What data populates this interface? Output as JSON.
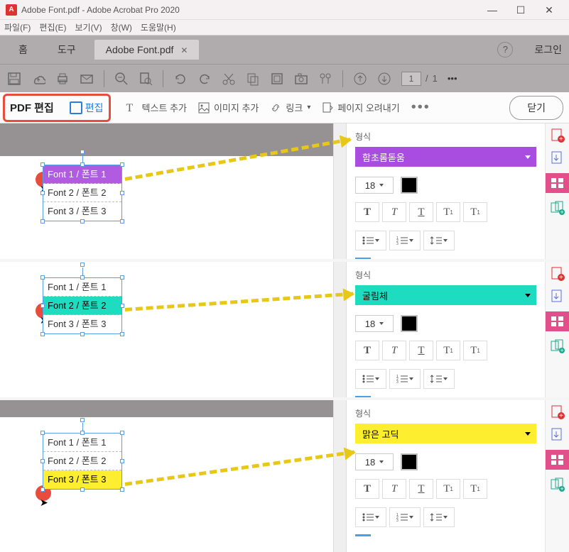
{
  "titlebar": {
    "title": "Adobe Font.pdf - Adobe Acrobat Pro 2020"
  },
  "menubar": {
    "file": "파일(F)",
    "edit": "편집(E)",
    "view": "보기(V)",
    "window": "창(W)",
    "help": "도움말(H)"
  },
  "tabs": {
    "home": "홈",
    "tools": "도구",
    "doc": "Adobe Font.pdf",
    "login": "로그인"
  },
  "pagination": {
    "current": "1",
    "sep": "/",
    "total": "1"
  },
  "editbar": {
    "pdf_edit": "PDF 편집",
    "edit": "편집",
    "add_text": "텍스트 추가",
    "add_image": "이미지 추가",
    "link": "링크",
    "crop": "페이지 오려내기",
    "close": "닫기"
  },
  "format": {
    "label": "형식",
    "size": "18"
  },
  "fonts": {
    "line1": "Font 1 / 폰트 1",
    "line2": "Font 2 / 폰트 2",
    "line3": "Font 3 / 폰트 3"
  },
  "font_names": {
    "purple": "함초롬돋움",
    "teal": "굴림체",
    "yellow": "맑은 고딕"
  },
  "style": {
    "bold": "T",
    "italic": "T",
    "under": "T",
    "sup": "T¹",
    "sub": "T₁"
  },
  "colors": {
    "purple": "#a84de0",
    "teal": "#1edcc0",
    "yellow": "#fdee2f",
    "red": "#e74c3c",
    "blue": "#2a7de1"
  }
}
